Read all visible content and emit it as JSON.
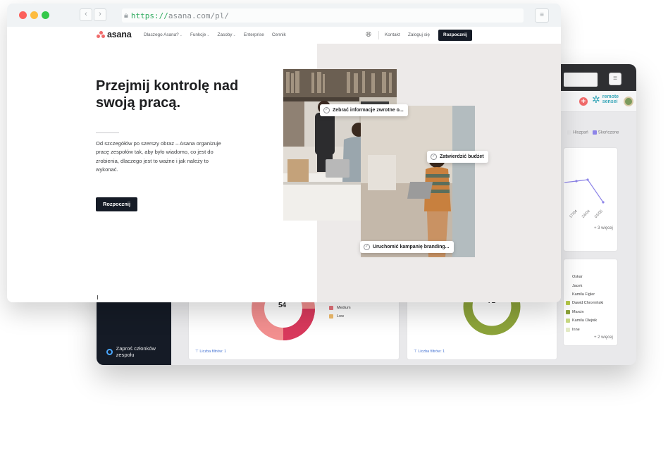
{
  "browser": {
    "url_scheme": "https://",
    "url_rest": "asana.com/pl/"
  },
  "site_nav": {
    "logo_text": "asana",
    "links": [
      "Dlaczego Asana?",
      "Funkcje",
      "Zasoby",
      "Enterprise",
      "Cennik"
    ],
    "contact": "Kontakt",
    "login": "Zaloguj się",
    "cta": "Rozpocznij"
  },
  "hero": {
    "headline": "Przejmij kontrolę nad swoją pracą.",
    "description": "Od szczegółów po szerszy obraz – Asana organizuje pracę zespołów tak, aby było wiadomo, co jest do zrobienia, dlaczego jest to ważne i jak należy to wykonać.",
    "cta": "Rozpocznij"
  },
  "tasks": [
    "Zebrać informacje zwrotne o...",
    "Zatwierdzić budżet",
    "Uruchomić kampanię branding..."
  ],
  "dashboard": {
    "logo_text_1": "remote",
    "logo_text_2": "sensei",
    "legend_top": [
      "Hiszpań",
      "Skończone"
    ],
    "dates": [
      "17/04",
      "24/04",
      "01/05"
    ],
    "more_top": "+ 3 więcej",
    "people": [
      "Oskar",
      "Jacek",
      "Kamila Figler",
      "Dawid Chromiński",
      "Marcin",
      "Kamila Olejnik",
      "Inne"
    ],
    "people_colors": [
      "#ffffff",
      "#ffffff",
      "#ffffff",
      "#b6c94a",
      "#8ca33a",
      "#c8d983",
      "#e3eac4"
    ],
    "more_people": "+ 2 więcej",
    "donut_left_value": "54",
    "donut_right_value": "71",
    "priority_legend": [
      "Medium",
      "Low"
    ],
    "priority_colors": [
      "#e8747c",
      "#f1bd6c"
    ],
    "filter_left": "⊤ Liczba filtrów: 1",
    "filter_right": "⊤ Liczba filtrów: 1",
    "invite": "Zaproś członków zespołu"
  }
}
